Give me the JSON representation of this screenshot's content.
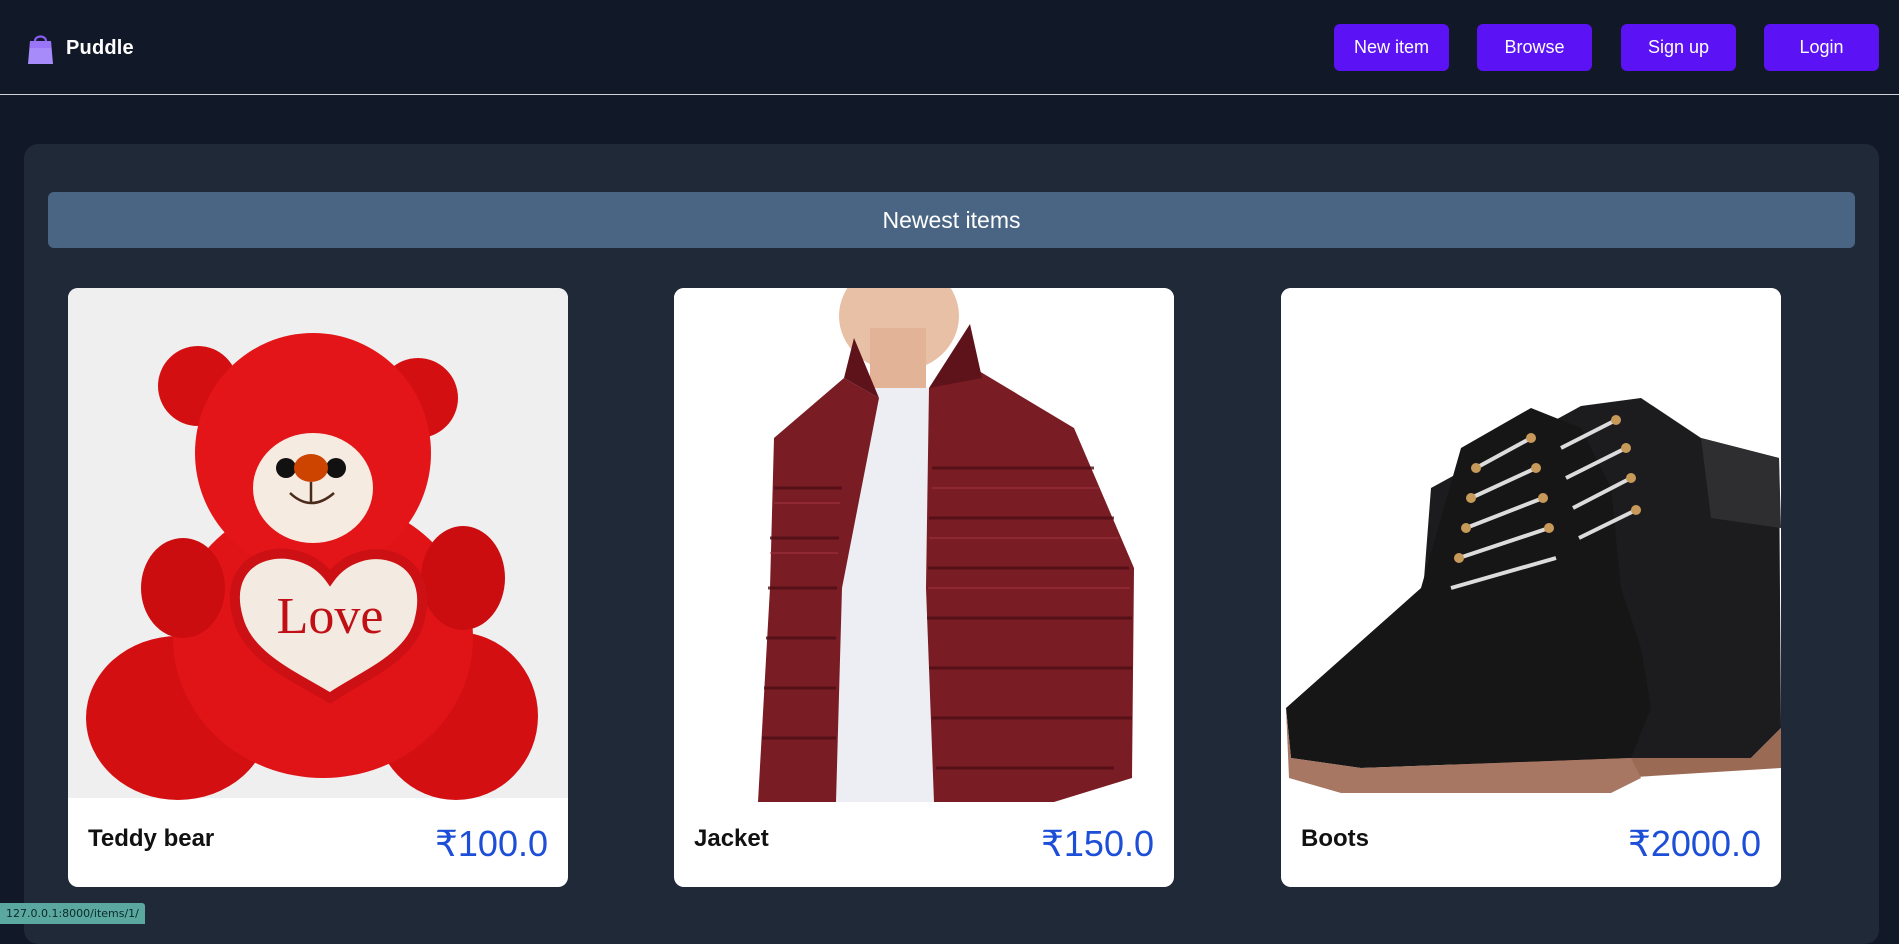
{
  "brand": {
    "name": "Puddle",
    "icon": "shopping-bag-icon",
    "icon_color": "#a78bfa"
  },
  "nav": {
    "new_item": "New item",
    "browse": "Browse",
    "signup": "Sign up",
    "login": "Login",
    "button_color": "#5b12f5"
  },
  "section": {
    "title": "Newest items"
  },
  "items": [
    {
      "name": "Teddy bear",
      "price": "₹100.0",
      "image": "teddy-bear-image"
    },
    {
      "name": "Jacket",
      "price": "₹150.0",
      "image": "jacket-image"
    },
    {
      "name": "Boots",
      "price": "₹2000.0",
      "image": "boots-image"
    }
  ],
  "status_bar": {
    "url": "127.0.0.1:8000/items/1/"
  },
  "colors": {
    "background": "#111827",
    "panel": "#1f2937",
    "section_header": "#4a6583",
    "price": "#1d4ed8"
  }
}
